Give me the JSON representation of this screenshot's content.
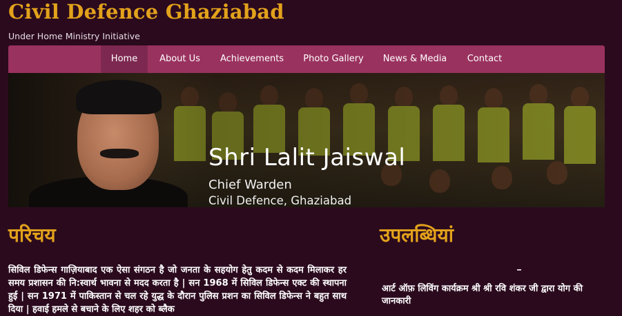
{
  "header": {
    "title": "Civil Defence Ghaziabad",
    "subtitle": "Under Home Ministry Initiative"
  },
  "nav": {
    "items": [
      {
        "label": "Home",
        "active": true
      },
      {
        "label": "About Us"
      },
      {
        "label": "Achievements"
      },
      {
        "label": "Photo Gallery"
      },
      {
        "label": "News & Media"
      },
      {
        "label": "Contact"
      }
    ]
  },
  "banner": {
    "name": "Shri Lalit Jaiswal",
    "role": "Chief Warden",
    "org": "Civil Defence, Ghaziabad"
  },
  "intro": {
    "heading": "परिचय",
    "body": "सिविल डिफेन्स गाज़ियाबाद एक ऐसा संगठन है जो जनता के सहयोग हेतु कदम से कदम मिलाकर हर समय प्रशासन की नि:स्वार्थ भावना से मदद करता है | सन 1968 में सिविल डिफेन्स एक्ट की स्थापना हुई | सन 1971 में पाकिस्तान से चल रहे युद्ध के दौरान पुलिस प्रशन का सिविल डिफेन्स ने बहुत साथ दिया | हवाई हमले से बचाने के लिए शहर को ब्लैक"
  },
  "achievements": {
    "heading": "उपलब्धियां",
    "items": [
      "आर्ट ऑफ़ लिविंग कार्यक्रम श्री श्री रवि शंकर जी द्वारा योग की जानकारी"
    ]
  },
  "colors": {
    "background": "#2b0a1e",
    "accent": "#e2a21b",
    "nav": "#9a325f",
    "nav_active": "#7d2850"
  }
}
